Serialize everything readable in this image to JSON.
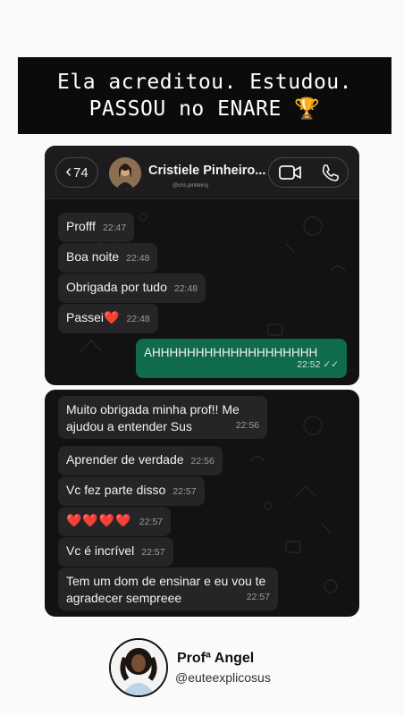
{
  "headline": {
    "line1": "Ela acreditou. Estudou.",
    "line2": "PASSOU no ENARE",
    "trophy_icon": "🏆"
  },
  "chat_header": {
    "back_count": "74",
    "contact_name": "Cristiele Pinheiro...",
    "contact_handle": "@cris.pinheiroj"
  },
  "panel1_messages": [
    {
      "text": "Profff",
      "time": "22:47"
    },
    {
      "text": "Boa noite",
      "time": "22:48"
    },
    {
      "text": "Obrigada por tudo",
      "time": "22:48"
    },
    {
      "text": "Passei",
      "emoji": "❤️",
      "time": "22:48"
    },
    {
      "text": "AHHHHHHHHHHHHHHHHHHH",
      "time": "22:52",
      "outgoing": true
    }
  ],
  "panel2_messages": [
    {
      "text": "Muito obrigada minha prof!! Me ajudou a entender Sus",
      "time": "22:56"
    },
    {
      "text": "Aprender de verdade",
      "time": "22:56"
    },
    {
      "text": "Vc fez parte disso",
      "time": "22:57"
    },
    {
      "text": "❤️❤️❤️❤️",
      "time": "22:57"
    },
    {
      "text": "Vc é incrível",
      "time": "22:57"
    },
    {
      "text": "Tem um dom de ensinar e eu vou te agradecer sempreee",
      "time": "22:57"
    }
  ],
  "profile": {
    "name": "Profª Angel",
    "handle": "@euteexplicosus"
  },
  "colors": {
    "outgoing_bubble": "#0f6b4c",
    "incoming_bubble": "#252527",
    "panel_bg": "#121212",
    "heart": "#e0242c"
  }
}
